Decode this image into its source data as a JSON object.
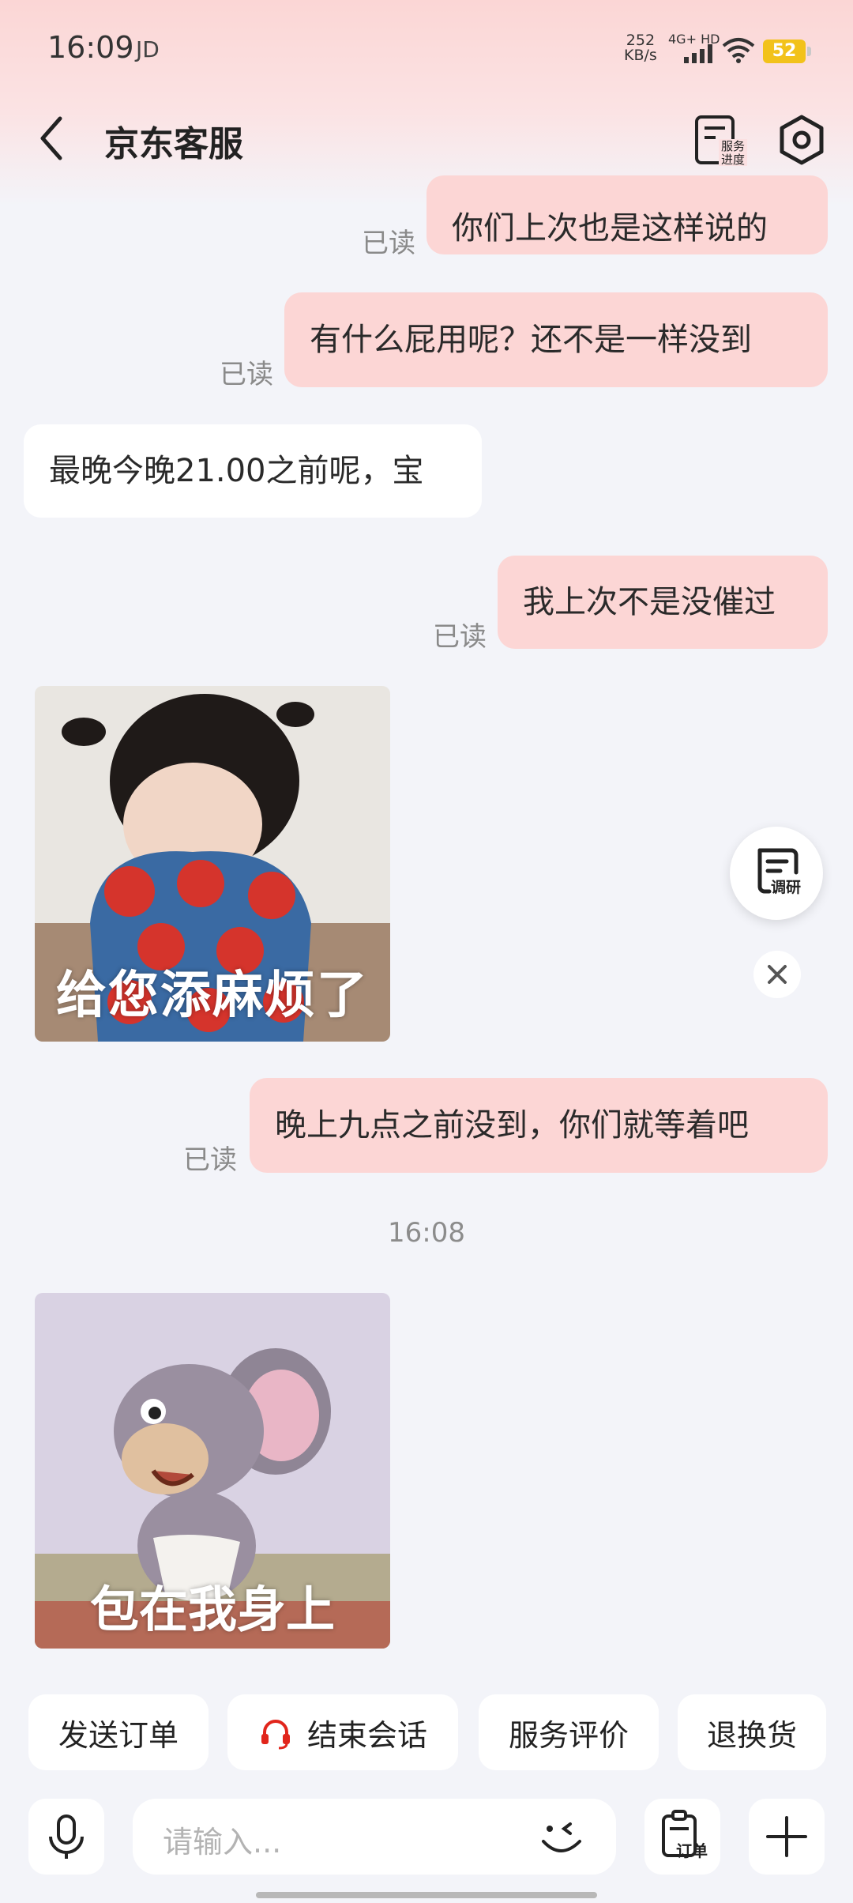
{
  "status_bar": {
    "time": "16:09",
    "carrier_logo": "JD",
    "net_speed_value": "252",
    "net_speed_unit": "KB/s",
    "signal_label": "4G+ HD",
    "battery": "52"
  },
  "header": {
    "title": "京东客服",
    "progress_label_line1": "服务",
    "progress_label_line2": "进度"
  },
  "messages": [
    {
      "text": "你们上次也是这样说的",
      "read": "已读"
    },
    {
      "text": "有什么屁用呢？还不是一样没到",
      "read": "已读"
    },
    {
      "text": "最晚今晚21.00之前呢，宝"
    },
    {
      "text": "我上次不是没催过",
      "read": "已读"
    },
    {
      "sticker_caption": "给您添麻烦了"
    },
    {
      "text": "晚上九点之前没到，你们就等着吧",
      "read": "已读"
    },
    {
      "timestamp": "16:08"
    },
    {
      "sticker_caption": "包在我身上"
    }
  ],
  "floating": {
    "survey_label": "调研"
  },
  "quick_actions": [
    "发送订单",
    "结束会话",
    "服务评价",
    "退换货"
  ],
  "input": {
    "placeholder": "请输入...",
    "order_label": "订单"
  },
  "colors": {
    "my_bubble": "#fcd6d5",
    "their_bubble": "#ffffff",
    "background": "#f3f4f9",
    "accent": "#e1251b"
  }
}
